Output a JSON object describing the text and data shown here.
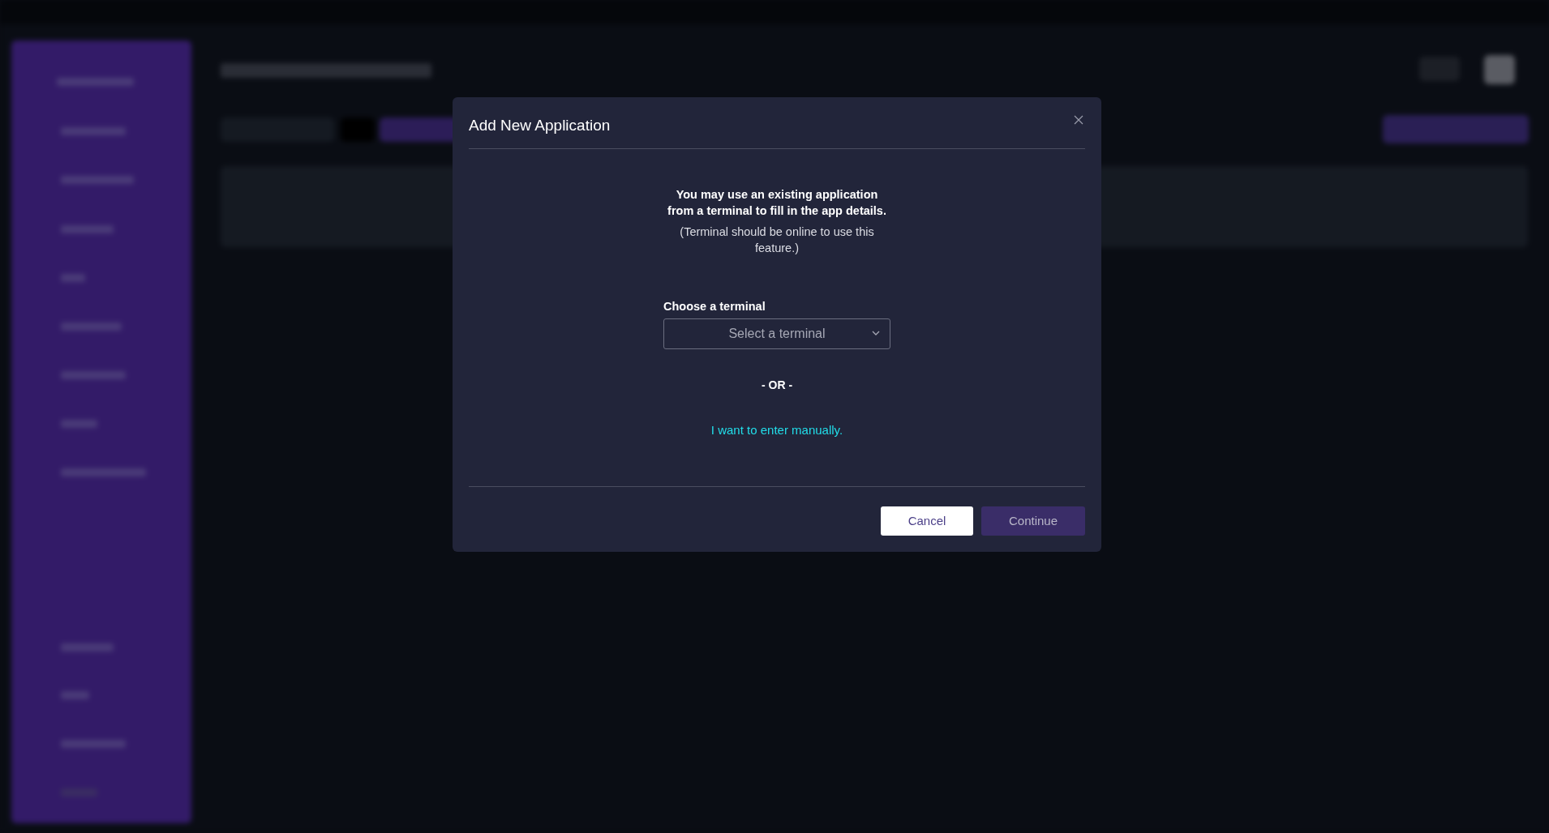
{
  "dialog": {
    "title": "Add New Application",
    "intro": "You may use an existing application from a terminal to fill in the app details.",
    "note": "(Terminal should be online to use this feature.)",
    "terminal_field": {
      "label": "Choose a terminal",
      "placeholder": "Select a terminal"
    },
    "separator": "- OR -",
    "manual_link": "I want to enter manually.",
    "buttons": [
      {
        "label": "Cancel",
        "kind": "secondary"
      },
      {
        "label": "Continue",
        "kind": "primary"
      }
    ]
  }
}
